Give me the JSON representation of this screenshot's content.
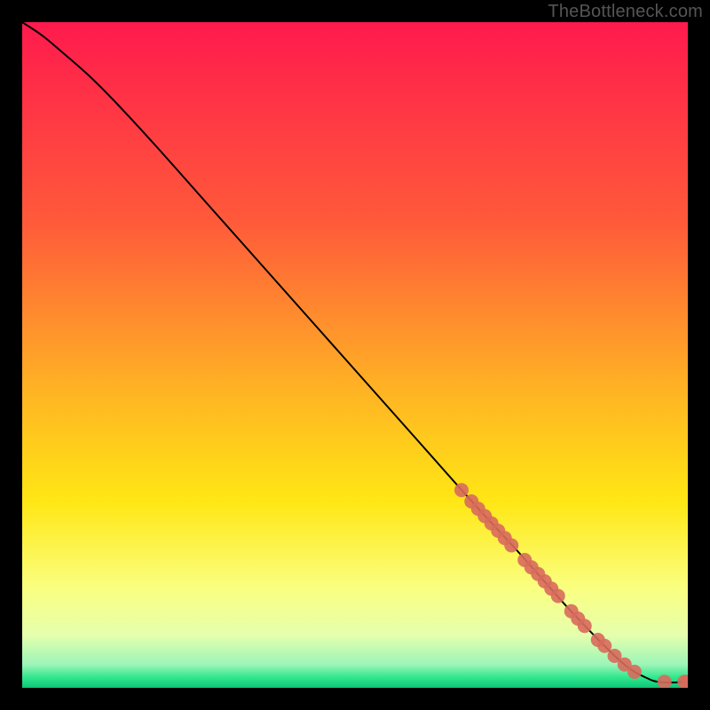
{
  "watermark": "TheBottleneck.com",
  "chart_data": {
    "type": "line",
    "title": "",
    "xlabel": "",
    "ylabel": "",
    "xlim": [
      0,
      100
    ],
    "ylim": [
      0,
      100
    ],
    "background_gradient": [
      {
        "pos": 0.0,
        "color": "#ff1a4d"
      },
      {
        "pos": 0.3,
        "color": "#ff5a3a"
      },
      {
        "pos": 0.55,
        "color": "#ffb224"
      },
      {
        "pos": 0.72,
        "color": "#ffe714"
      },
      {
        "pos": 0.85,
        "color": "#faff80"
      },
      {
        "pos": 0.92,
        "color": "#e6ffad"
      },
      {
        "pos": 0.965,
        "color": "#9cf5b8"
      },
      {
        "pos": 0.985,
        "color": "#2ee68c"
      },
      {
        "pos": 1.0,
        "color": "#0cc477"
      }
    ],
    "series": [
      {
        "name": "curve",
        "type": "line",
        "color": "#000000",
        "x": [
          0,
          3,
          6,
          10,
          14,
          20,
          28,
          36,
          44,
          52,
          60,
          68,
          74,
          78,
          82,
          86,
          88,
          90,
          92,
          94,
          95,
          96.5,
          98,
          100
        ],
        "y": [
          100,
          98,
          95.5,
          92,
          88,
          81.5,
          72.5,
          63.5,
          54.5,
          45.5,
          36.5,
          27.5,
          21,
          16.5,
          12,
          7.8,
          5.8,
          3.9,
          2.4,
          1.4,
          1.0,
          0.8,
          0.8,
          0.9
        ]
      },
      {
        "name": "markers",
        "type": "scatter",
        "color": "#d86a5c",
        "radius": 8,
        "points": [
          {
            "x": 66.0,
            "y": 29.7
          },
          {
            "x": 67.5,
            "y": 28.0
          },
          {
            "x": 68.5,
            "y": 26.9
          },
          {
            "x": 69.5,
            "y": 25.8
          },
          {
            "x": 70.5,
            "y": 24.7
          },
          {
            "x": 71.5,
            "y": 23.6
          },
          {
            "x": 72.5,
            "y": 22.5
          },
          {
            "x": 73.5,
            "y": 21.4
          },
          {
            "x": 75.5,
            "y": 19.2
          },
          {
            "x": 76.5,
            "y": 18.1
          },
          {
            "x": 77.5,
            "y": 17.1
          },
          {
            "x": 78.5,
            "y": 16.0
          },
          {
            "x": 79.5,
            "y": 14.9
          },
          {
            "x": 80.5,
            "y": 13.8
          },
          {
            "x": 82.5,
            "y": 11.5
          },
          {
            "x": 83.5,
            "y": 10.4
          },
          {
            "x": 84.5,
            "y": 9.3
          },
          {
            "x": 86.5,
            "y": 7.2
          },
          {
            "x": 87.5,
            "y": 6.3
          },
          {
            "x": 89.0,
            "y": 4.8
          },
          {
            "x": 90.5,
            "y": 3.5
          },
          {
            "x": 92.0,
            "y": 2.4
          },
          {
            "x": 96.5,
            "y": 0.9
          },
          {
            "x": 99.5,
            "y": 0.9
          },
          {
            "x": 100.0,
            "y": 0.9
          }
        ]
      }
    ]
  }
}
